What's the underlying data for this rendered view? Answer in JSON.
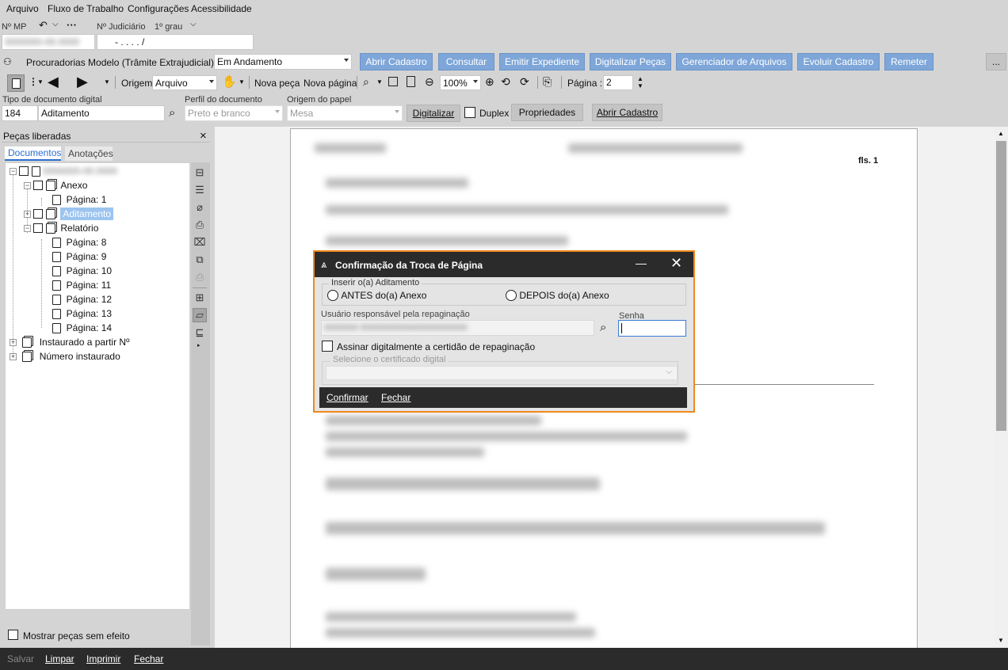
{
  "menu": {
    "arquivo": "Arquivo",
    "fluxo": "Fluxo de Trabalho",
    "config": "Configurações",
    "acess": "Acessibilidade"
  },
  "header": {
    "nmp_label": "Nº MP",
    "judicial_label": "Nº Judiciário",
    "grau_label": "1º grau",
    "judicial_value": "- .  . . .  /",
    "nmp_value": "0000000-00.0000"
  },
  "fila": {
    "label": "Procuradorias Modelo (Trâmite Extrajudicial) - Fila",
    "value": "Em Andamento"
  },
  "actions": [
    "Abrir Cadastro",
    "Consultar",
    "Emitir Expediente",
    "Digitalizar Peças",
    "Gerenciador de Arquivos",
    "Evoluir Cadastro",
    "Remeter"
  ],
  "more_label": "...",
  "toolbar": {
    "origem_label": "Origem",
    "origem_value": "Arquivo",
    "nova_peca": "Nova peça",
    "nova_pagina": "Nova página",
    "zoom": "100%",
    "pagina_label": "Página :",
    "pagina_value": "2"
  },
  "digit": {
    "tipo_label": "Tipo de documento digital",
    "tipo_code": "184",
    "tipo_value": "Aditamento",
    "perfil_label": "Perfil do documento",
    "perfil_value": "Preto e branco",
    "origem_label": "Origem do papel",
    "origem_value": "Mesa",
    "digitalizar": "Digitalizar",
    "duplex": "Duplex",
    "propriedades": "Propriedades",
    "abrir": "Abrir Cadastro"
  },
  "panel": {
    "title": "Peças liberadas",
    "close": "×",
    "tab_docs": "Documentos",
    "tab_notes": "Anotações",
    "root_value": "0000000-00.0000",
    "tree": {
      "anexo": "Anexo",
      "pag1": "Página: 1",
      "aditamento": "Aditamento",
      "relatorio": "Relatório",
      "pags": [
        "Página: 8",
        "Página: 9",
        "Página: 10",
        "Página: 11",
        "Página: 12",
        "Página: 13",
        "Página: 14"
      ],
      "instaurado": "Instaurado a partir Nº",
      "numero": "Número instaurado"
    },
    "mostrar": "Mostrar peças sem efeito"
  },
  "document": {
    "fls": "fls. 1"
  },
  "dialog": {
    "title": "Confirmação da Troca de Página",
    "group_label": "Inserir o(a) Aditamento",
    "antes": "ANTES do(a) Anexo",
    "depois": "DEPOIS do(a) Anexo",
    "usuario_label": "Usuário responsável pela repaginação",
    "senha_label": "Senha",
    "usuario_value": "0000000   0000000000000000000000",
    "assinar": "Assinar digitalmente a certidão de repaginação",
    "cert_label": "Selecione o certificado digital",
    "confirmar": "Confirmar",
    "fechar": "Fechar"
  },
  "status": {
    "salvar": "Salvar",
    "limpar": "Limpar",
    "imprimir": "Imprimir",
    "fechar": "Fechar"
  },
  "colors": {
    "accent": "#7ea6d8",
    "dialog_border": "#f08a1e",
    "dark_bar": "#2b2b2b",
    "selection": "#9cc4ef"
  }
}
